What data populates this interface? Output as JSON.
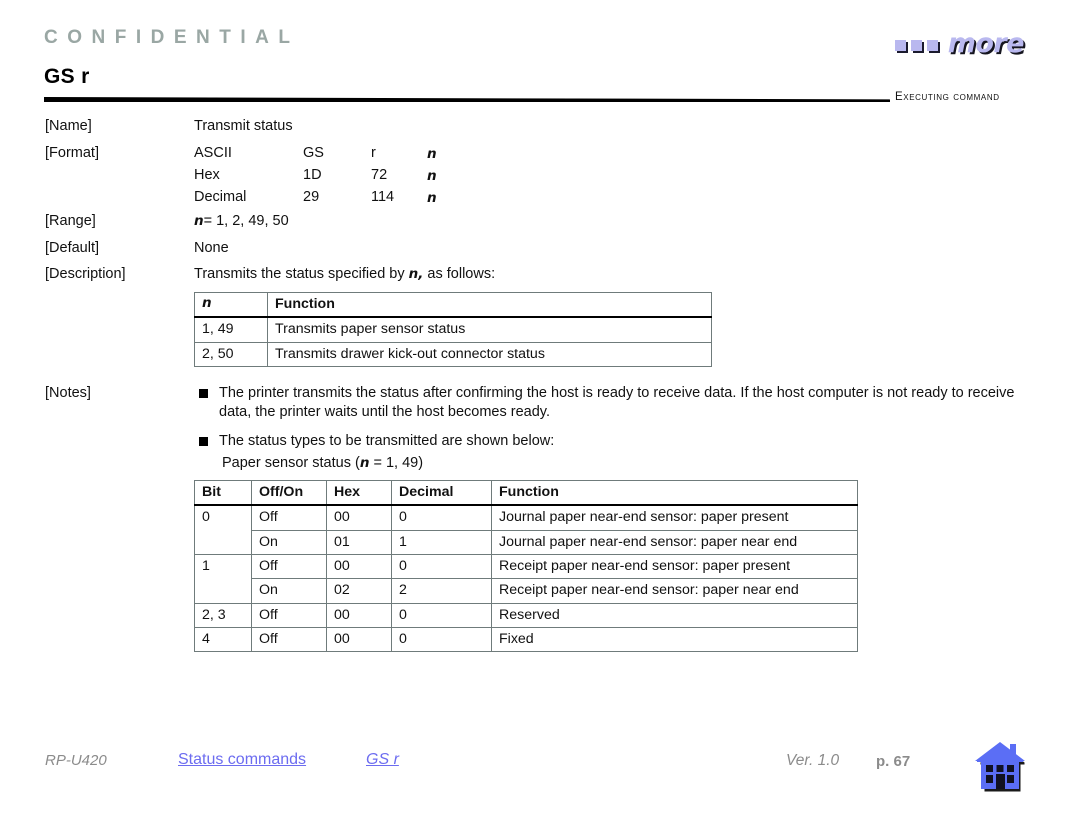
{
  "header": {
    "confidential": "CONFIDENTIAL",
    "logo_text": "more",
    "command_title": "GS r",
    "section_tag": "Executing command"
  },
  "fields": {
    "name_label": "[Name]",
    "name_value": "Transmit status",
    "format_label": "[Format]",
    "format_rows": [
      {
        "type": "ASCII",
        "a": "GS",
        "b": "r",
        "c": "n"
      },
      {
        "type": "Hex",
        "a": "1D",
        "b": "72",
        "c": "n"
      },
      {
        "type": "Decimal",
        "a": "29",
        "b": "114",
        "c": "n"
      }
    ],
    "range_label": "[Range]",
    "range_var": "n",
    "range_value": "= 1, 2, 49, 50",
    "default_label": "[Default]",
    "default_value": "None",
    "description_label": "[Description]",
    "description_pre": "Transmits the status specified by ",
    "description_var": "n,",
    "description_post": " as follows:",
    "notes_label": "[Notes]"
  },
  "n_table": {
    "headers": [
      "n",
      "Function"
    ],
    "rows": [
      [
        "1, 49",
        "Transmits paper sensor status"
      ],
      [
        "2, 50",
        "Transmits drawer kick-out connector status"
      ]
    ]
  },
  "notes": [
    "The printer transmits the status after confirming the host is ready to receive data. If the host computer is not ready to receive data, the printer waits until the host becomes ready.",
    "The status types to be transmitted are shown below:"
  ],
  "sub_caption": {
    "pre": "Paper sensor status (",
    "var": "n",
    "post": " = 1, 49)"
  },
  "bit_table": {
    "headers": [
      "Bit",
      "Off/On",
      "Hex",
      "Decimal",
      "Function"
    ],
    "rows": [
      {
        "bit": "0",
        "offon": "Off",
        "hex": "00",
        "dec": "0",
        "func": "Journal paper near-end sensor: paper present",
        "bit_rowspan": 2
      },
      {
        "bit": "",
        "offon": "On",
        "hex": "01",
        "dec": "1",
        "func": "Journal paper near-end sensor: paper near end",
        "bit_rowspan": 0
      },
      {
        "bit": "1",
        "offon": "Off",
        "hex": "00",
        "dec": "0",
        "func": "Receipt paper near-end sensor: paper present",
        "bit_rowspan": 2
      },
      {
        "bit": "",
        "offon": "On",
        "hex": "02",
        "dec": "2",
        "func": "Receipt paper near-end sensor: paper near end",
        "bit_rowspan": 0
      },
      {
        "bit": "2, 3",
        "offon": "Off",
        "hex": "00",
        "dec": "0",
        "func": "Reserved",
        "bit_rowspan": 1
      },
      {
        "bit": "4",
        "offon": "Off",
        "hex": "00",
        "dec": "0",
        "func": "Fixed",
        "bit_rowspan": 1
      }
    ]
  },
  "footer": {
    "model": "RP-U420",
    "section_link": "Status commands",
    "command_link": "GS r",
    "version": "Ver. 1.0",
    "page": "p. 67",
    "home_icon": "house-icon"
  },
  "colors": {
    "confidential": "#9aa7a4",
    "logo": "#b9b8ef",
    "link": "#6c6cf0",
    "footer_gray": "#8b8b8b",
    "house": "#5b6ef5"
  }
}
